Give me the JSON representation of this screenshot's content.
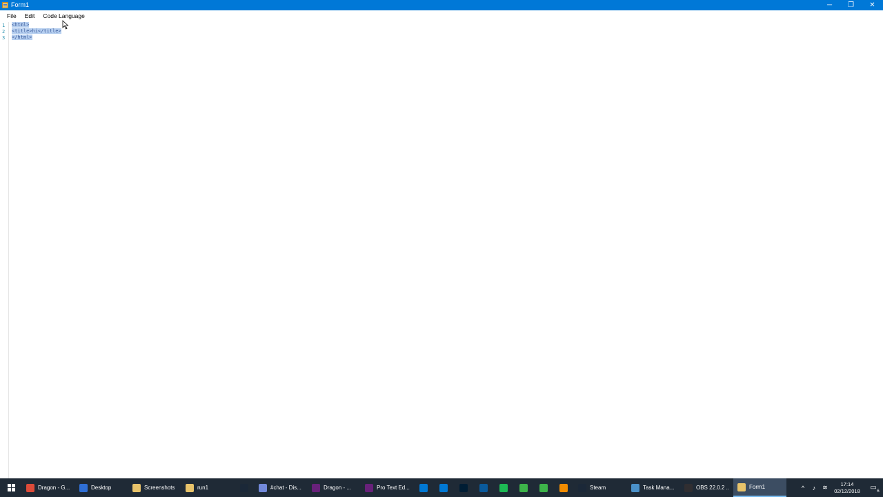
{
  "window": {
    "title": "Form1",
    "minimize_glyph": "─",
    "restore_glyph": "❐",
    "close_glyph": "✕"
  },
  "menu": {
    "items": [
      "File",
      "Edit",
      "Code Language"
    ]
  },
  "editor": {
    "lines": [
      {
        "number": "1",
        "text": "<html>"
      },
      {
        "number": "2",
        "text": "<title>hi</title>"
      },
      {
        "number": "3",
        "text": "</html>"
      }
    ],
    "selection_color": "#b6cff0"
  },
  "taskbar": {
    "items": [
      {
        "label": "Dragon - G...",
        "icon": "chrome-icon",
        "color": "#dd4b39"
      },
      {
        "label": "Desktop",
        "icon": "folder-icon",
        "color": "#2f6fd6"
      },
      {
        "label": "Screenshots",
        "icon": "folder-icon",
        "color": "#e8c36a"
      },
      {
        "label": "run1",
        "icon": "folder-icon",
        "color": "#e8c36a"
      },
      {
        "label": "",
        "icon": "steam-icon",
        "color": "#1b2838"
      },
      {
        "label": "#chat - Dis...",
        "icon": "discord-icon",
        "color": "#7289da"
      },
      {
        "label": "Dragon - ...",
        "icon": "visual-studio-icon",
        "color": "#68217a"
      },
      {
        "label": "Pro Text Ed...",
        "icon": "visual-studio-icon",
        "color": "#68217a"
      },
      {
        "label": "",
        "icon": "vscode-icon",
        "color": "#0078d4"
      },
      {
        "label": "",
        "icon": "store-icon",
        "color": "#0078d4"
      },
      {
        "label": "",
        "icon": "photoshop-icon",
        "color": "#001d34"
      },
      {
        "label": "",
        "icon": "v-app-icon",
        "color": "#0a5a9c"
      },
      {
        "label": "",
        "icon": "spotify-icon",
        "color": "#1db954"
      },
      {
        "label": "",
        "icon": "green-app-icon",
        "color": "#3db34a"
      },
      {
        "label": "",
        "icon": "green-app-icon",
        "color": "#3db34a"
      },
      {
        "label": "",
        "icon": "vlc-icon",
        "color": "#f28c00"
      },
      {
        "label": "Steam",
        "icon": "steam-icon",
        "color": "#1b2838"
      },
      {
        "label": "Task Mana...",
        "icon": "task-manager-icon",
        "color": "#4a90c8"
      },
      {
        "label": "OBS 22.0.2 ...",
        "icon": "obs-icon",
        "color": "#302e31"
      },
      {
        "label": "Form1",
        "icon": "form-icon",
        "color": "#e8c36a",
        "active": true
      }
    ],
    "clock_time": "17:14",
    "clock_date": "02/12/2018",
    "notification_count": "6"
  }
}
